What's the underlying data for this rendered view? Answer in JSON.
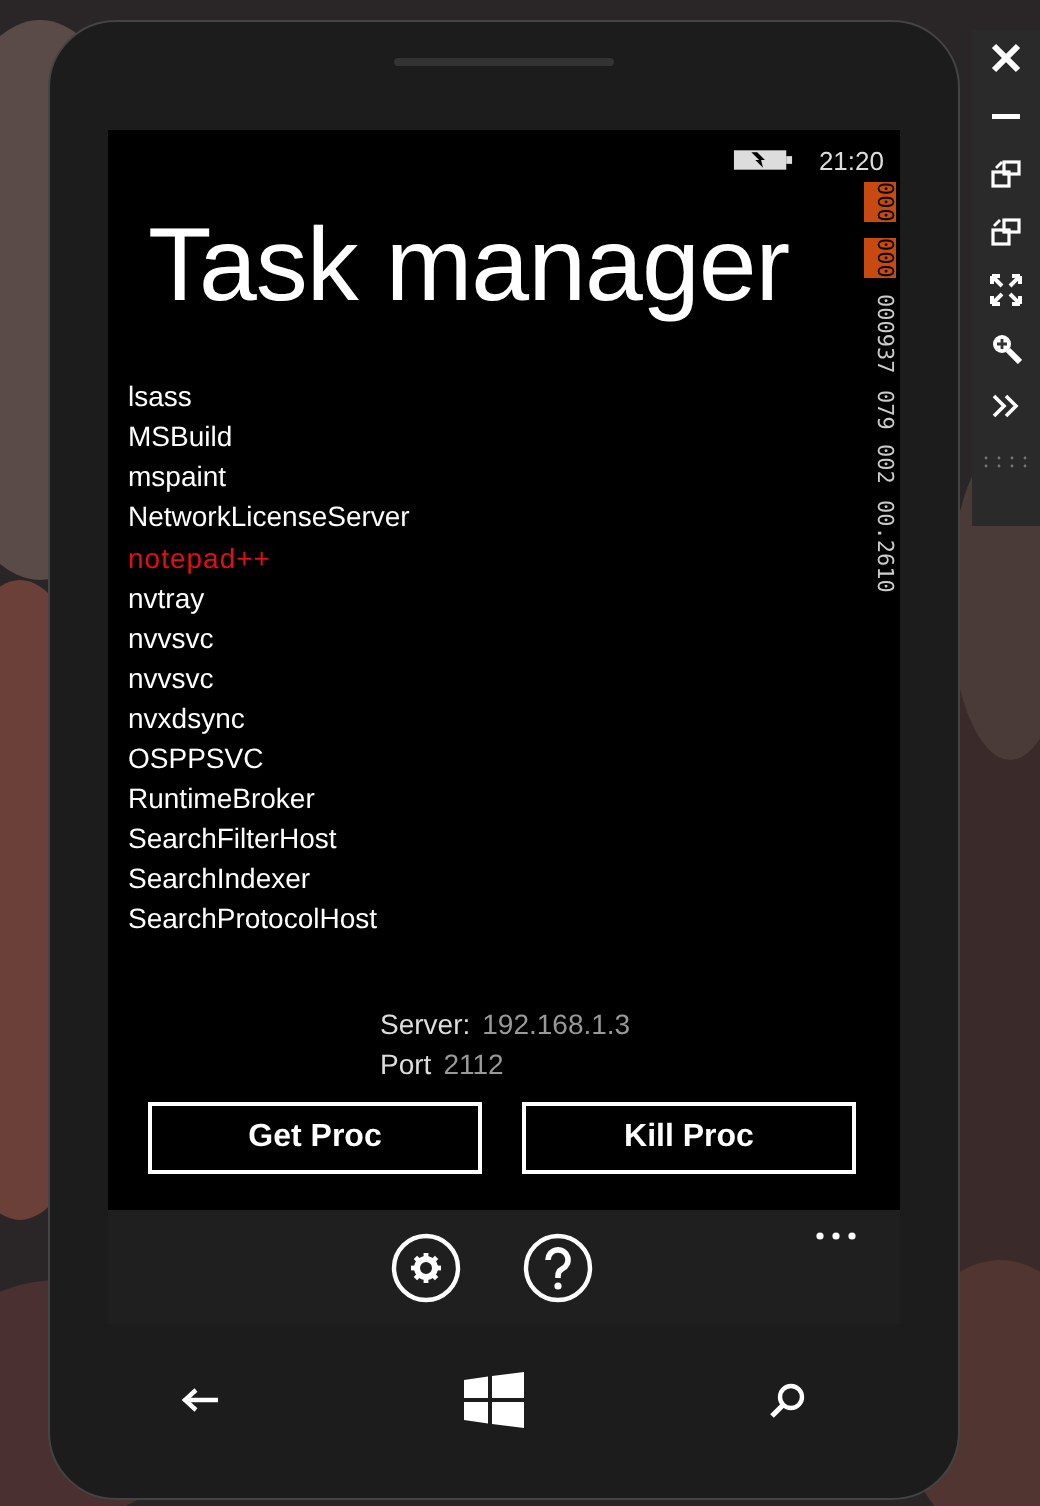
{
  "status_bar": {
    "time": "21:20"
  },
  "title": "Task manager",
  "frame_counter": [
    {
      "text": "000",
      "highlighted": true
    },
    {
      "text": "000",
      "highlighted": true
    },
    {
      "text": "000937",
      "highlighted": false
    },
    {
      "text": "079",
      "highlighted": false
    },
    {
      "text": "002",
      "highlighted": false
    },
    {
      "text": "00.2610",
      "highlighted": false
    }
  ],
  "processes": [
    {
      "name": "lsass",
      "selected": false
    },
    {
      "name": "MSBuild",
      "selected": false
    },
    {
      "name": "mspaint",
      "selected": false
    },
    {
      "name": "NetworkLicenseServer",
      "selected": false
    },
    {
      "name": "notepad++",
      "selected": true
    },
    {
      "name": "nvtray",
      "selected": false
    },
    {
      "name": "nvvsvc",
      "selected": false
    },
    {
      "name": "nvvsvc",
      "selected": false
    },
    {
      "name": "nvxdsync",
      "selected": false
    },
    {
      "name": "OSPPSVC",
      "selected": false
    },
    {
      "name": "RuntimeBroker",
      "selected": false
    },
    {
      "name": "SearchFilterHost",
      "selected": false
    },
    {
      "name": "SearchIndexer",
      "selected": false
    },
    {
      "name": "SearchProtocolHost",
      "selected": false
    }
  ],
  "server": {
    "label": "Server:",
    "value": "192.168.1.3"
  },
  "port": {
    "label": "Port",
    "value": "2112"
  },
  "buttons": [
    "Get Proc",
    "Kill Proc"
  ]
}
